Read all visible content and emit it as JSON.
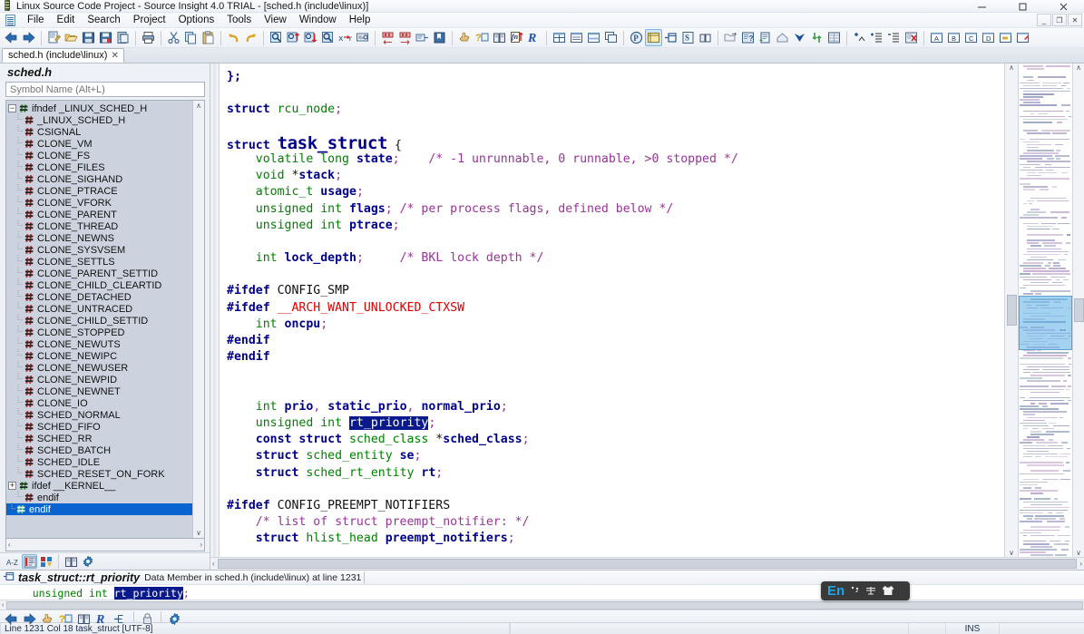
{
  "window": {
    "title": "Linux Source Code Project - Source Insight 4.0 TRIAL - [sched.h (include\\linux)]",
    "app_icon": "source-insight-icon",
    "controls": {
      "minimize": "minimize-icon",
      "restore": "restore-icon",
      "close": "close-icon"
    },
    "mdi_controls": {
      "minimize": "_",
      "restore": "❐",
      "close": "✕"
    }
  },
  "menubar": {
    "items": [
      "File",
      "Edit",
      "Search",
      "Project",
      "Options",
      "Tools",
      "View",
      "Window",
      "Help"
    ]
  },
  "toolbar": {
    "groups": [
      [
        "back-arrow-icon",
        "forward-arrow-icon"
      ],
      [
        "new-file-icon",
        "open-file-icon",
        "save-icon",
        "save-all-icon",
        "save-as-icon"
      ],
      [
        "print-icon"
      ],
      [
        "cut-icon",
        "copy-icon",
        "paste-icon"
      ],
      [
        "undo-icon",
        "redo-icon"
      ],
      [
        "search-icon",
        "search-up-icon",
        "search-down-icon",
        "search-files-icon",
        "replace-icon",
        "replace-files-icon"
      ],
      [
        "bookmark-prev-icon",
        "bookmark-next-icon",
        "bookmark-toggle-icon",
        "bookmark-list-icon"
      ],
      [
        "browse-symbol-icon",
        "symbol-info-icon",
        "reference-book-icon",
        "jump-to-definition-icon",
        "relation-window-icon"
      ],
      [
        "tile-window-icon",
        "horizontal-split-icon",
        "split-window-icon",
        "cascade-window-icon"
      ],
      [
        "project-window-icon",
        "symbol-window-icon",
        "context-window-icon",
        "clip-window-icon",
        "smart-rename-icon"
      ],
      [
        "open-project-icon",
        "sync-files-icon",
        "add-file-icon",
        "remove-file-icon",
        "export-icon",
        "rebuild-project-icon",
        "compare-files-icon"
      ],
      [
        "add-condition-icon",
        "increase-indent-icon",
        "decrease-indent-icon",
        "clear-conditions-icon"
      ],
      [
        "window-a-icon",
        "window-b-icon",
        "window-c-icon",
        "window-d-icon",
        "window-e-icon",
        "window-new-icon"
      ]
    ]
  },
  "tabs": [
    {
      "label": "sched.h (include\\linux)",
      "close": "✕",
      "active": true
    }
  ],
  "sidebar": {
    "title": "sched.h",
    "search_placeholder": "Symbol Name (Alt+L)",
    "search_value": "",
    "items": [
      {
        "label": "ifndef _LINUX_SCHED_H",
        "depth": 0,
        "expander": "−",
        "icon": "define-symbol-icon"
      },
      {
        "label": "_LINUX_SCHED_H",
        "depth": 1,
        "icon": "define-symbol-icon"
      },
      {
        "label": "CSIGNAL",
        "depth": 1,
        "icon": "define-symbol-icon"
      },
      {
        "label": "CLONE_VM",
        "depth": 1,
        "icon": "define-symbol-icon"
      },
      {
        "label": "CLONE_FS",
        "depth": 1,
        "icon": "define-symbol-icon"
      },
      {
        "label": "CLONE_FILES",
        "depth": 1,
        "icon": "define-symbol-icon"
      },
      {
        "label": "CLONE_SIGHAND",
        "depth": 1,
        "icon": "define-symbol-icon"
      },
      {
        "label": "CLONE_PTRACE",
        "depth": 1,
        "icon": "define-symbol-icon"
      },
      {
        "label": "CLONE_VFORK",
        "depth": 1,
        "icon": "define-symbol-icon"
      },
      {
        "label": "CLONE_PARENT",
        "depth": 1,
        "icon": "define-symbol-icon"
      },
      {
        "label": "CLONE_THREAD",
        "depth": 1,
        "icon": "define-symbol-icon"
      },
      {
        "label": "CLONE_NEWNS",
        "depth": 1,
        "icon": "define-symbol-icon"
      },
      {
        "label": "CLONE_SYSVSEM",
        "depth": 1,
        "icon": "define-symbol-icon"
      },
      {
        "label": "CLONE_SETTLS",
        "depth": 1,
        "icon": "define-symbol-icon"
      },
      {
        "label": "CLONE_PARENT_SETTID",
        "depth": 1,
        "icon": "define-symbol-icon"
      },
      {
        "label": "CLONE_CHILD_CLEARTID",
        "depth": 1,
        "icon": "define-symbol-icon"
      },
      {
        "label": "CLONE_DETACHED",
        "depth": 1,
        "icon": "define-symbol-icon"
      },
      {
        "label": "CLONE_UNTRACED",
        "depth": 1,
        "icon": "define-symbol-icon"
      },
      {
        "label": "CLONE_CHILD_SETTID",
        "depth": 1,
        "icon": "define-symbol-icon"
      },
      {
        "label": "CLONE_STOPPED",
        "depth": 1,
        "icon": "define-symbol-icon"
      },
      {
        "label": "CLONE_NEWUTS",
        "depth": 1,
        "icon": "define-symbol-icon"
      },
      {
        "label": "CLONE_NEWIPC",
        "depth": 1,
        "icon": "define-symbol-icon"
      },
      {
        "label": "CLONE_NEWUSER",
        "depth": 1,
        "icon": "define-symbol-icon"
      },
      {
        "label": "CLONE_NEWPID",
        "depth": 1,
        "icon": "define-symbol-icon"
      },
      {
        "label": "CLONE_NEWNET",
        "depth": 1,
        "icon": "define-symbol-icon"
      },
      {
        "label": "CLONE_IO",
        "depth": 1,
        "icon": "define-symbol-icon"
      },
      {
        "label": "SCHED_NORMAL",
        "depth": 1,
        "icon": "define-symbol-icon"
      },
      {
        "label": "SCHED_FIFO",
        "depth": 1,
        "icon": "define-symbol-icon"
      },
      {
        "label": "SCHED_RR",
        "depth": 1,
        "icon": "define-symbol-icon"
      },
      {
        "label": "SCHED_BATCH",
        "depth": 1,
        "icon": "define-symbol-icon"
      },
      {
        "label": "SCHED_IDLE",
        "depth": 1,
        "icon": "define-symbol-icon"
      },
      {
        "label": "SCHED_RESET_ON_FORK",
        "depth": 1,
        "icon": "define-symbol-icon"
      },
      {
        "label": "ifdef __KERNEL__",
        "depth": 0,
        "expander": "+",
        "icon": "define-symbol-icon"
      },
      {
        "label": "endif",
        "depth": 1,
        "icon": "define-symbol-icon"
      },
      {
        "label": "endif",
        "depth": 0,
        "icon": "define-symbol-icon",
        "selected": true
      }
    ],
    "bottom_buttons": [
      {
        "icon": "sort-alphabetical-icon",
        "active": false
      },
      {
        "icon": "list-view-icon",
        "active": true
      },
      {
        "icon": "type-filter-icon",
        "active": false
      },
      {
        "icon": "reference-book-icon",
        "active": false
      },
      {
        "icon": "gear-icon",
        "active": false
      }
    ],
    "hscroll": {
      "left": "‹",
      "right": "›"
    },
    "vscroll": {
      "up": "∧",
      "down": "∨"
    }
  },
  "editor": {
    "lines": [
      [
        {
          "t": "};",
          "c": "kw"
        }
      ],
      [],
      [
        {
          "t": "struct",
          "c": "kw"
        },
        {
          "t": " ",
          "c": "plain"
        },
        {
          "t": "rcu_node",
          "c": "typ"
        },
        {
          "t": ";",
          "c": "punct"
        }
      ],
      [],
      [
        {
          "t": "struct",
          "c": "kw"
        },
        {
          "t": " ",
          "c": "plain"
        },
        {
          "t": "task_struct",
          "c": "bigid"
        },
        {
          "t": " {",
          "c": "plain"
        }
      ],
      [
        {
          "t": "    ",
          "c": "plain"
        },
        {
          "t": "volatile long",
          "c": "typ"
        },
        {
          "t": " ",
          "c": "plain"
        },
        {
          "t": "state",
          "c": "mem"
        },
        {
          "t": ";",
          "c": "punct"
        },
        {
          "t": "    ",
          "c": "plain"
        },
        {
          "t": "/* -1 unrunnable, 0 runnable, >0 stopped */",
          "c": "cmt"
        }
      ],
      [
        {
          "t": "    ",
          "c": "plain"
        },
        {
          "t": "void",
          "c": "typ"
        },
        {
          "t": " *",
          "c": "plain"
        },
        {
          "t": "stack",
          "c": "mem"
        },
        {
          "t": ";",
          "c": "punct"
        }
      ],
      [
        {
          "t": "    ",
          "c": "plain"
        },
        {
          "t": "atomic_t",
          "c": "typ"
        },
        {
          "t": " ",
          "c": "plain"
        },
        {
          "t": "usage",
          "c": "mem"
        },
        {
          "t": ";",
          "c": "punct"
        }
      ],
      [
        {
          "t": "    ",
          "c": "plain"
        },
        {
          "t": "unsigned int",
          "c": "typ"
        },
        {
          "t": " ",
          "c": "plain"
        },
        {
          "t": "flags",
          "c": "mem"
        },
        {
          "t": ";",
          "c": "punct"
        },
        {
          "t": " ",
          "c": "plain"
        },
        {
          "t": "/* per process flags, defined below */",
          "c": "cmt"
        }
      ],
      [
        {
          "t": "    ",
          "c": "plain"
        },
        {
          "t": "unsigned int",
          "c": "typ"
        },
        {
          "t": " ",
          "c": "plain"
        },
        {
          "t": "ptrace",
          "c": "mem"
        },
        {
          "t": ";",
          "c": "punct"
        }
      ],
      [],
      [
        {
          "t": "    ",
          "c": "plain"
        },
        {
          "t": "int",
          "c": "typ"
        },
        {
          "t": " ",
          "c": "plain"
        },
        {
          "t": "lock_depth",
          "c": "mem"
        },
        {
          "t": ";",
          "c": "punct"
        },
        {
          "t": "     ",
          "c": "plain"
        },
        {
          "t": "/* BKL lock depth */",
          "c": "cmt"
        }
      ],
      [],
      [
        {
          "t": "#ifdef",
          "c": "pre"
        },
        {
          "t": " CONFIG_SMP",
          "c": "plain"
        }
      ],
      [
        {
          "t": "#ifdef",
          "c": "pre"
        },
        {
          "t": " ",
          "c": "plain"
        },
        {
          "t": "__ARCH_WANT_UNLOCKED_CTXSW",
          "c": "red"
        }
      ],
      [
        {
          "t": "    ",
          "c": "plain"
        },
        {
          "t": "int",
          "c": "typ"
        },
        {
          "t": " ",
          "c": "plain"
        },
        {
          "t": "oncpu",
          "c": "mem"
        },
        {
          "t": ";",
          "c": "punct"
        }
      ],
      [
        {
          "t": "#endif",
          "c": "pre"
        }
      ],
      [
        {
          "t": "#endif",
          "c": "pre"
        }
      ],
      [],
      [],
      [
        {
          "t": "    ",
          "c": "plain"
        },
        {
          "t": "int",
          "c": "typ"
        },
        {
          "t": " ",
          "c": "plain"
        },
        {
          "t": "prio",
          "c": "mem"
        },
        {
          "t": ", ",
          "c": "punct"
        },
        {
          "t": "static_prio",
          "c": "mem"
        },
        {
          "t": ", ",
          "c": "punct"
        },
        {
          "t": "normal_prio",
          "c": "mem"
        },
        {
          "t": ";",
          "c": "punct"
        }
      ],
      [
        {
          "t": "    ",
          "c": "plain"
        },
        {
          "t": "unsigned int",
          "c": "typ"
        },
        {
          "t": " ",
          "c": "plain"
        },
        {
          "t": "rt_priority",
          "c": "sel"
        },
        {
          "t": ";",
          "c": "punct"
        }
      ],
      [
        {
          "t": "    ",
          "c": "plain"
        },
        {
          "t": "const",
          "c": "kw"
        },
        {
          "t": " ",
          "c": "plain"
        },
        {
          "t": "struct",
          "c": "kw"
        },
        {
          "t": " ",
          "c": "plain"
        },
        {
          "t": "sched_class",
          "c": "typ"
        },
        {
          "t": " *",
          "c": "plain"
        },
        {
          "t": "sched_class",
          "c": "mem"
        },
        {
          "t": ";",
          "c": "punct"
        }
      ],
      [
        {
          "t": "    ",
          "c": "plain"
        },
        {
          "t": "struct",
          "c": "kw"
        },
        {
          "t": " ",
          "c": "plain"
        },
        {
          "t": "sched_entity",
          "c": "typ"
        },
        {
          "t": " ",
          "c": "plain"
        },
        {
          "t": "se",
          "c": "mem"
        },
        {
          "t": ";",
          "c": "punct"
        }
      ],
      [
        {
          "t": "    ",
          "c": "plain"
        },
        {
          "t": "struct",
          "c": "kw"
        },
        {
          "t": " ",
          "c": "plain"
        },
        {
          "t": "sched_rt_entity",
          "c": "typ"
        },
        {
          "t": " ",
          "c": "plain"
        },
        {
          "t": "rt",
          "c": "mem"
        },
        {
          "t": ";",
          "c": "punct"
        }
      ],
      [],
      [
        {
          "t": "#ifdef",
          "c": "pre"
        },
        {
          "t": " CONFIG_PREEMPT_NOTIFIERS",
          "c": "plain"
        }
      ],
      [
        {
          "t": "    ",
          "c": "plain"
        },
        {
          "t": "/* list of struct preempt_notifier: */",
          "c": "cmt"
        }
      ],
      [
        {
          "t": "    ",
          "c": "plain"
        },
        {
          "t": "struct",
          "c": "kw"
        },
        {
          "t": " ",
          "c": "plain"
        },
        {
          "t": "hlist_head",
          "c": "typ"
        },
        {
          "t": " ",
          "c": "plain"
        },
        {
          "t": "preempt_notifiers",
          "c": "mem"
        },
        {
          "t": ";",
          "c": "punct"
        }
      ]
    ],
    "vscroll": {
      "up": "∧",
      "down": "∨"
    },
    "hscroll": {
      "left": "‹",
      "right": "›"
    }
  },
  "minimap": {
    "name": "code-overview-minimap",
    "viewport_top_pct": 47,
    "viewport_height_pct": 11,
    "scroll": {
      "up": "∧",
      "down": "∨"
    }
  },
  "context_panel": {
    "icon": "context-window-icon",
    "symbol": "task_struct::rt_priority",
    "description": "Data Member in sched.h (include\\linux) at line 1231",
    "code": [
      {
        "t": "    ",
        "c": "plain"
      },
      {
        "t": "unsigned int",
        "c": "typ"
      },
      {
        "t": " ",
        "c": "plain"
      },
      {
        "t": "rt_priority",
        "c": "sel"
      },
      {
        "t": ";",
        "c": "punct"
      }
    ],
    "hscroll": {
      "left": "‹"
    },
    "toolbar": [
      "back-arrow-icon",
      "forward-arrow-icon",
      "browse-symbol-icon",
      "symbol-info-icon",
      "reference-book-icon",
      "relation-window-icon",
      "jump-to-definition-icon",
      "lock-icon",
      "gear-icon"
    ]
  },
  "statusbar": {
    "main": "Line 1231  Col 18  task_struct [UTF-8]",
    "mid": "",
    "insert_mode": "INS"
  },
  "ime_bar": {
    "language": "En",
    "punctuation_icon": "punctuation-toggle-icon",
    "width_icon": "halfwidth-fullwidth-icon",
    "skin_icon": "ime-skin-icon"
  },
  "colors": {
    "keyword": "#00008b",
    "type": "#008000",
    "comment": "#993399",
    "macro_red": "#dd0000",
    "selection_bg": "#0a1a8c",
    "tree_selection_bg": "#0a64d0",
    "minimap_viewport": "#5aafE6"
  }
}
